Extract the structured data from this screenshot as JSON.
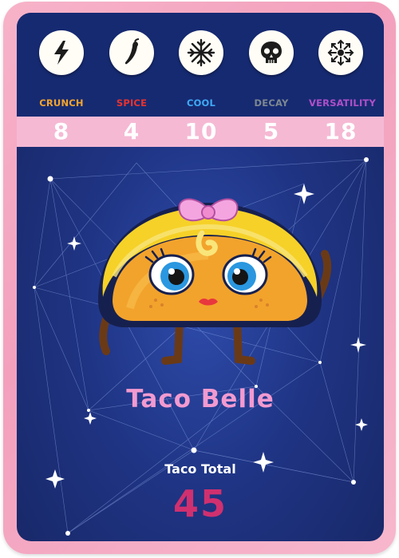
{
  "stats": [
    {
      "label": "CRUNCH",
      "value": "8",
      "icon": "lightning-bolt-icon",
      "color": "#f5a42a"
    },
    {
      "label": "SPICE",
      "value": "4",
      "icon": "chili-pepper-icon",
      "color": "#e8332e"
    },
    {
      "label": "COOL",
      "value": "10",
      "icon": "snowflake-icon",
      "color": "#3fa9f5"
    },
    {
      "label": "DECAY",
      "value": "5",
      "icon": "skull-icon",
      "color": "#7d8890"
    },
    {
      "label": "VERSATILITY",
      "value": "18",
      "icon": "arrows-outward-icon",
      "color": "#b04fc9"
    }
  ],
  "character": {
    "name": "Taco Belle",
    "image": "taco-character-with-pink-bow"
  },
  "total": {
    "label": "Taco Total",
    "value": "45"
  },
  "colors": {
    "card_border": "#f5a3c0",
    "background": "#1f3484",
    "name": "#f29ad0",
    "total": "#d0306f"
  }
}
